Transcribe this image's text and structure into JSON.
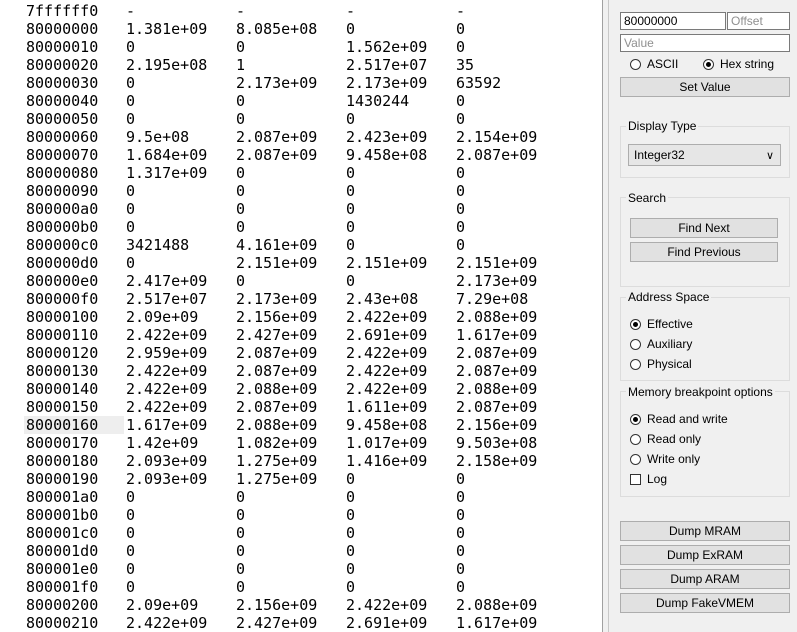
{
  "memory_rows": [
    {
      "addr": "7ffffff0",
      "c1": "-",
      "c2": "-",
      "c3": "-",
      "c4": "-"
    },
    {
      "addr": "80000000",
      "c1": "1.381e+09",
      "c2": "8.085e+08",
      "c3": "0",
      "c4": "0"
    },
    {
      "addr": "80000010",
      "c1": "0",
      "c2": "0",
      "c3": "1.562e+09",
      "c4": "0"
    },
    {
      "addr": "80000020",
      "c1": "2.195e+08",
      "c2": "1",
      "c3": "2.517e+07",
      "c4": "35"
    },
    {
      "addr": "80000030",
      "c1": "0",
      "c2": "2.173e+09",
      "c3": "2.173e+09",
      "c4": "63592"
    },
    {
      "addr": "80000040",
      "c1": "0",
      "c2": "0",
      "c3": "1430244",
      "c4": "0"
    },
    {
      "addr": "80000050",
      "c1": "0",
      "c2": "0",
      "c3": "0",
      "c4": "0"
    },
    {
      "addr": "80000060",
      "c1": "9.5e+08",
      "c2": "2.087e+09",
      "c3": "2.423e+09",
      "c4": "2.154e+09"
    },
    {
      "addr": "80000070",
      "c1": "1.684e+09",
      "c2": "2.087e+09",
      "c3": "9.458e+08",
      "c4": "2.087e+09"
    },
    {
      "addr": "80000080",
      "c1": "1.317e+09",
      "c2": "0",
      "c3": "0",
      "c4": "0"
    },
    {
      "addr": "80000090",
      "c1": "0",
      "c2": "0",
      "c3": "0",
      "c4": "0"
    },
    {
      "addr": "800000a0",
      "c1": "0",
      "c2": "0",
      "c3": "0",
      "c4": "0"
    },
    {
      "addr": "800000b0",
      "c1": "0",
      "c2": "0",
      "c3": "0",
      "c4": "0"
    },
    {
      "addr": "800000c0",
      "c1": "3421488",
      "c2": "4.161e+09",
      "c3": "0",
      "c4": "0"
    },
    {
      "addr": "800000d0",
      "c1": "0",
      "c2": "2.151e+09",
      "c3": "2.151e+09",
      "c4": "2.151e+09"
    },
    {
      "addr": "800000e0",
      "c1": "2.417e+09",
      "c2": "0",
      "c3": "0",
      "c4": "2.173e+09"
    },
    {
      "addr": "800000f0",
      "c1": "2.517e+07",
      "c2": "2.173e+09",
      "c3": "2.43e+08",
      "c4": "7.29e+08"
    },
    {
      "addr": "80000100",
      "c1": "2.09e+09",
      "c2": "2.156e+09",
      "c3": "2.422e+09",
      "c4": "2.088e+09"
    },
    {
      "addr": "80000110",
      "c1": "2.422e+09",
      "c2": "2.427e+09",
      "c3": "2.691e+09",
      "c4": "1.617e+09"
    },
    {
      "addr": "80000120",
      "c1": "2.959e+09",
      "c2": "2.087e+09",
      "c3": "2.422e+09",
      "c4": "2.087e+09"
    },
    {
      "addr": "80000130",
      "c1": "2.422e+09",
      "c2": "2.087e+09",
      "c3": "2.422e+09",
      "c4": "2.087e+09"
    },
    {
      "addr": "80000140",
      "c1": "2.422e+09",
      "c2": "2.088e+09",
      "c3": "2.422e+09",
      "c4": "2.088e+09"
    },
    {
      "addr": "80000150",
      "c1": "2.422e+09",
      "c2": "2.087e+09",
      "c3": "1.611e+09",
      "c4": "2.087e+09"
    },
    {
      "addr": "80000160",
      "c1": "1.617e+09",
      "c2": "2.088e+09",
      "c3": "9.458e+08",
      "c4": "2.156e+09"
    },
    {
      "addr": "80000170",
      "c1": "1.42e+09",
      "c2": "1.082e+09",
      "c3": "1.017e+09",
      "c4": "9.503e+08"
    },
    {
      "addr": "80000180",
      "c1": "2.093e+09",
      "c2": "1.275e+09",
      "c3": "1.416e+09",
      "c4": "2.158e+09"
    },
    {
      "addr": "80000190",
      "c1": "2.093e+09",
      "c2": "1.275e+09",
      "c3": "0",
      "c4": "0"
    },
    {
      "addr": "800001a0",
      "c1": "0",
      "c2": "0",
      "c3": "0",
      "c4": "0"
    },
    {
      "addr": "800001b0",
      "c1": "0",
      "c2": "0",
      "c3": "0",
      "c4": "0"
    },
    {
      "addr": "800001c0",
      "c1": "0",
      "c2": "0",
      "c3": "0",
      "c4": "0"
    },
    {
      "addr": "800001d0",
      "c1": "0",
      "c2": "0",
      "c3": "0",
      "c4": "0"
    },
    {
      "addr": "800001e0",
      "c1": "0",
      "c2": "0",
      "c3": "0",
      "c4": "0"
    },
    {
      "addr": "800001f0",
      "c1": "0",
      "c2": "0",
      "c3": "0",
      "c4": "0"
    },
    {
      "addr": "80000200",
      "c1": "2.09e+09",
      "c2": "2.156e+09",
      "c3": "2.422e+09",
      "c4": "2.088e+09"
    },
    {
      "addr": "80000210",
      "c1": "2.422e+09",
      "c2": "2.427e+09",
      "c3": "2.691e+09",
      "c4": "1.617e+09"
    }
  ],
  "highlighted_address": "80000160",
  "address_input": {
    "value": "80000000"
  },
  "offset_input": {
    "placeholder": "Offset"
  },
  "value_input": {
    "placeholder": "Value"
  },
  "encoding": {
    "ascii_label": "ASCII",
    "hex_label": "Hex string",
    "selected": "hex"
  },
  "set_value_label": "Set Value",
  "display_type": {
    "title": "Display Type",
    "selected": "Integer32"
  },
  "search": {
    "title": "Search",
    "find_next": "Find Next",
    "find_previous": "Find Previous"
  },
  "address_space": {
    "title": "Address Space",
    "options": [
      "Effective",
      "Auxiliary",
      "Physical"
    ],
    "selected": "Effective"
  },
  "breakpoint": {
    "title": "Memory breakpoint options",
    "options": [
      "Read and write",
      "Read only",
      "Write only"
    ],
    "selected": "Read and write",
    "log_label": "Log",
    "log_checked": false
  },
  "dump_buttons": [
    "Dump MRAM",
    "Dump ExRAM",
    "Dump ARAM",
    "Dump FakeVMEM"
  ]
}
